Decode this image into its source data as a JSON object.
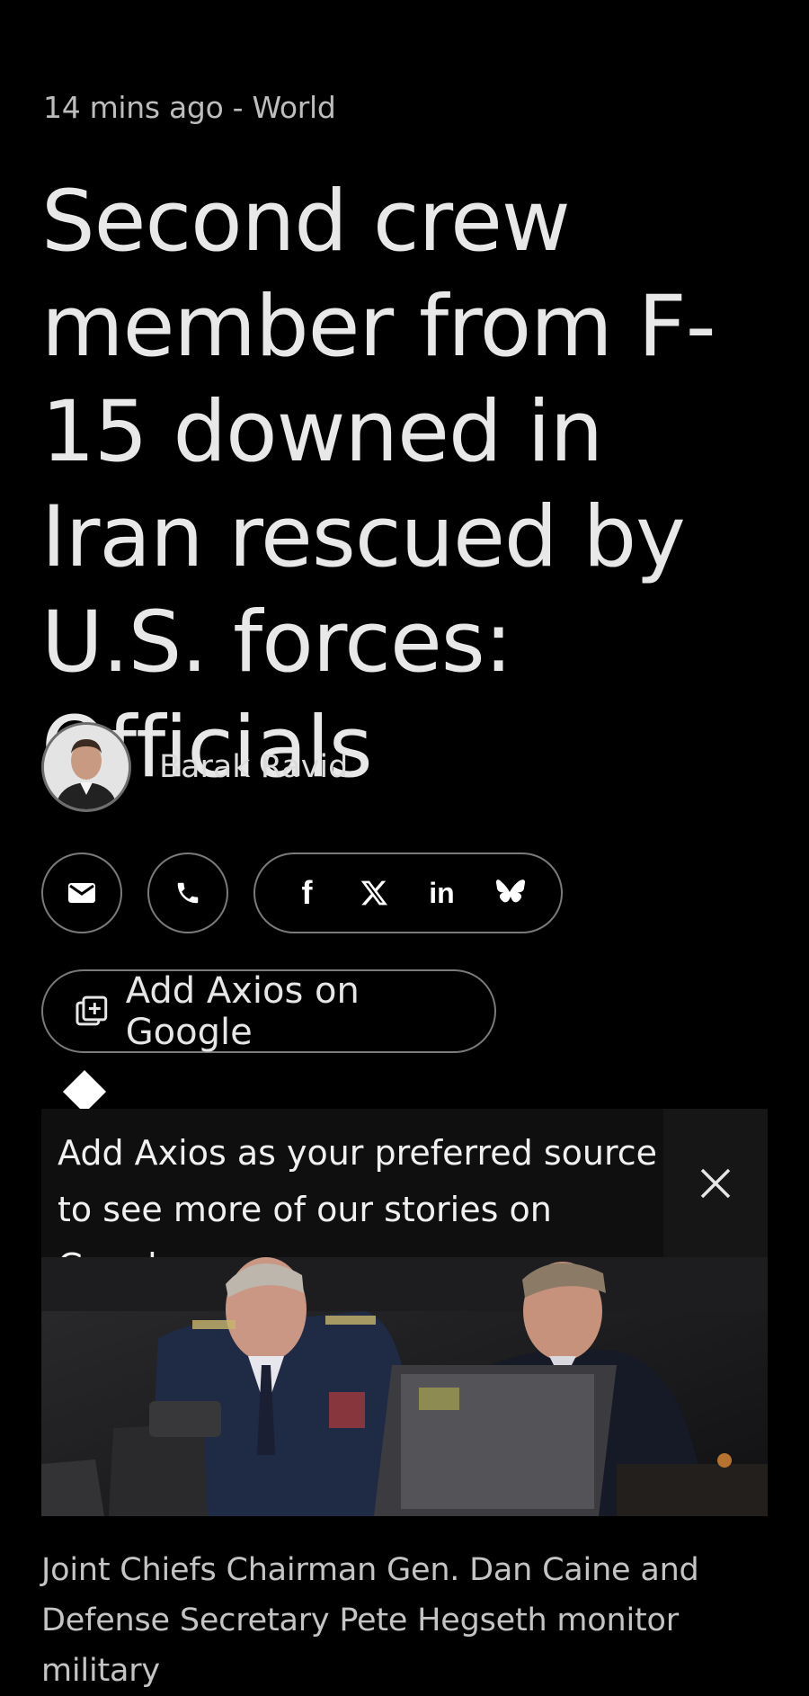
{
  "article": {
    "timestamp": "14 mins ago",
    "separator": " - ",
    "section": "World",
    "headline": "Second crew member from F-15 downed in Iran rescued by U.S. forces: Officials",
    "author": "Barak Ravid"
  },
  "share": {
    "email_icon": "envelope-icon",
    "phone_icon": "phone-icon",
    "networks": [
      {
        "name": "facebook",
        "glyph": "f"
      },
      {
        "name": "x",
        "glyph": "𝕏"
      },
      {
        "name": "linkedin",
        "glyph": "in"
      },
      {
        "name": "bluesky",
        "glyph": "butterfly"
      }
    ]
  },
  "google_cta": {
    "label": "Add Axios on Google",
    "icon": "add-to-library-icon"
  },
  "tooltip": {
    "text": "Add Axios as your preferred source to see more of our stories on Google.",
    "close_icon": "close-icon"
  },
  "photo": {
    "caption": "Joint Chiefs Chairman Gen. Dan Caine and Defense Secretary Pete Hegseth monitor military"
  },
  "colors": {
    "background": "#000000",
    "text": "#e6e6e6",
    "border": "#7a7a7a",
    "tooltip_bg": "#0f0f0f"
  }
}
